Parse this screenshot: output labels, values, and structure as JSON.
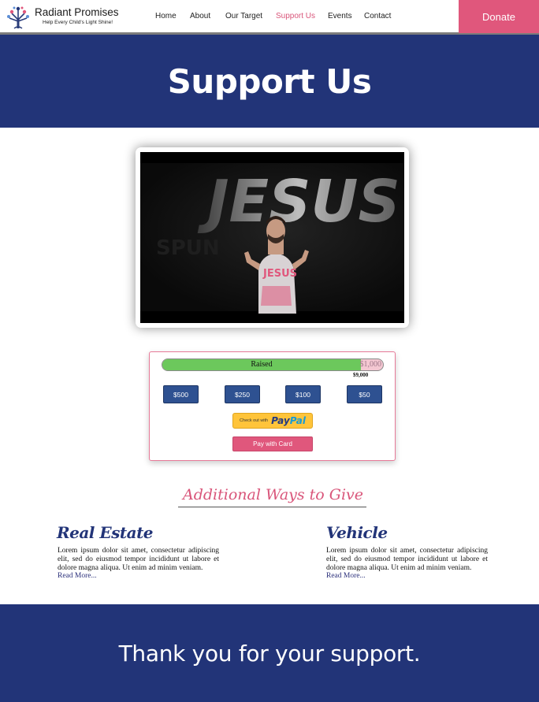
{
  "header": {
    "brand_name": "Radiant Promises",
    "brand_tagline": "Help Every Child's Light Shine!",
    "nav": [
      "Home",
      "About",
      "Our Target",
      "Support Us",
      "Events",
      "Contact"
    ],
    "active_nav": "Support Us",
    "donate_label": "Donate"
  },
  "hero": {
    "title": "Support Us"
  },
  "video": {
    "overlay_text_large": "JESUS",
    "overlay_text_small": "SPUN",
    "shirt_text": "JESUS"
  },
  "donation": {
    "progress_label": "Raised",
    "goal_label": "$1,000",
    "raised_amount": "$9,000",
    "progress_fraction": 0.9,
    "amount_buttons": [
      "$500",
      "$250",
      "$100",
      "$50"
    ],
    "paypal_prefix": "Check out with",
    "paypal_brand_1": "Pay",
    "paypal_brand_2": "Pal",
    "card_button": "Pay with Card"
  },
  "additional": {
    "title": "Additional Ways to Give",
    "columns": [
      {
        "title": "Real Estate",
        "text": "Lorem ipsum dolor sit amet, consectetur adipiscing elit, sed do eiusmod tempor incididunt ut labore et dolore magna aliqua. Ut enim ad minim veniam.",
        "link": "Read More..."
      },
      {
        "title": "Vehicle",
        "text": "Lorem ipsum dolor sit amet, consectetur adipiscing elit, sed do eiusmod tempor incididunt ut labore et dolore magna aliqua. Ut enim ad minim veniam.",
        "link": "Read More..."
      }
    ]
  },
  "footer": {
    "message": "Thank you for your support."
  },
  "colors": {
    "navy": "#223478",
    "pink": "#e0577c",
    "button_blue": "#2e5191",
    "progress_green": "#6cc85c"
  }
}
